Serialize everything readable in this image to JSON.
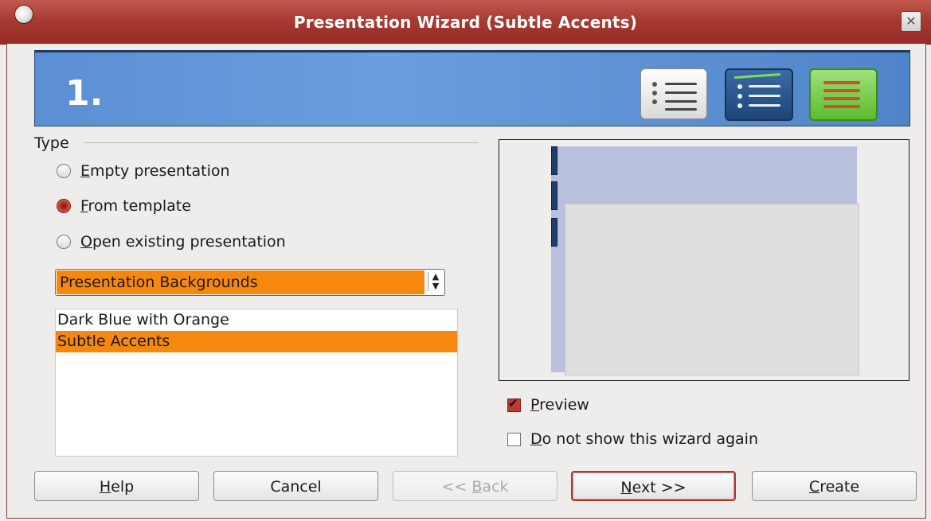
{
  "window": {
    "title": "Presentation Wizard (Subtle Accents)",
    "close_icon": "close-icon",
    "app_icon": "openoffice-icon"
  },
  "banner": {
    "step": "1.",
    "icons": [
      "list-icon",
      "outline-icon",
      "notes-icon"
    ]
  },
  "type_group": {
    "label": "Type",
    "options": [
      {
        "accel": "E",
        "rest": "mpty presentation",
        "checked": false
      },
      {
        "accel": "F",
        "rest": "rom template",
        "checked": true
      },
      {
        "accel": "O",
        "rest": "pen existing presentation",
        "checked": false
      }
    ]
  },
  "category_select": {
    "value": "Presentation Backgrounds"
  },
  "template_list": {
    "items": [
      "Dark Blue with Orange",
      "Subtle Accents"
    ],
    "selected_index": 1
  },
  "preview_checkbox": {
    "accel": "P",
    "rest": "review",
    "checked": true
  },
  "dont_show_checkbox": {
    "accel": "D",
    "rest": "o not show this wizard again",
    "checked": false
  },
  "buttons": {
    "help": {
      "accel": "H",
      "rest": "elp"
    },
    "cancel": {
      "label": "Cancel"
    },
    "back": {
      "prefix": "<< ",
      "accel": "B",
      "rest": "ack"
    },
    "next": {
      "accel": "N",
      "rest": "ext >>"
    },
    "create": {
      "accel": "C",
      "rest": "reate"
    }
  }
}
